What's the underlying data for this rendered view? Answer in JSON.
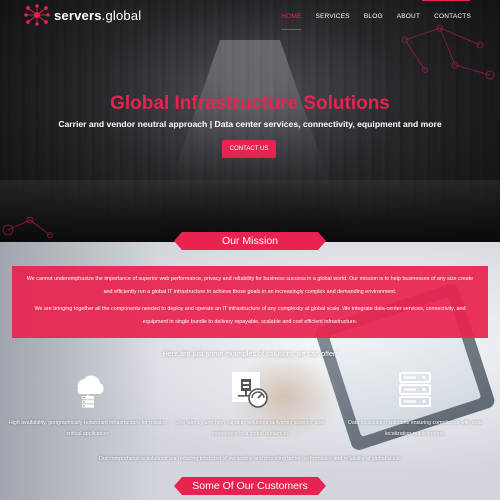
{
  "brand": {
    "name_bold": "servers",
    "name_rest": ".global"
  },
  "nav": {
    "items": [
      {
        "label": "HOME",
        "active": true
      },
      {
        "label": "SERVICES",
        "active": false
      },
      {
        "label": "BLOG",
        "active": false
      },
      {
        "label": "ABOUT",
        "active": false
      },
      {
        "label": "CONTACTS",
        "active": false
      }
    ]
  },
  "hero": {
    "title": "Global Infrastructure Solutions",
    "subtitle": "Carrier and vendor neutral approach | Data center services, connectivity, equipment and more",
    "cta_label": "CONTACT US"
  },
  "mission": {
    "heading": "Our Mission",
    "paragraph_1": "We cannot underemphasize the importance of superior web performance, privacy and reliability for business success in a global world. Our mission is to help businesses of any size create and efficiently run a global IT infrastructure to achieve those goals in an increasingly complex and demanding environment.",
    "paragraph_2": "We are bringing together all the components needed to deploy and operate an IT infrastructure of any complexity at global scale. We integrate data-center services, connectivity, and equipment in single bundle to delivery repayable, scalable and cost efficient infrastructure.",
    "examples_title": "Here are just some examples of solutions we can offer:",
    "features": [
      {
        "icon": "cloud-server-icon",
        "text": "High availability, geographically redundant infrastructure for mission critical application;"
      },
      {
        "icon": "network-speed-icon",
        "text": "Low latency and high capacity solutions delivering superior user experience to a global audience;"
      },
      {
        "icon": "server-rack-icon",
        "text": "Data localization solutions ensuring compliance with data localization requirements."
      }
    ],
    "closing": "Our comprehensive solutions are reducing total cost of ownership and providing better performance and reliability at global scale."
  },
  "customers": {
    "heading": "Some Of Our Customers"
  },
  "colors": {
    "accent": "#e8234f",
    "white": "#ffffff"
  }
}
